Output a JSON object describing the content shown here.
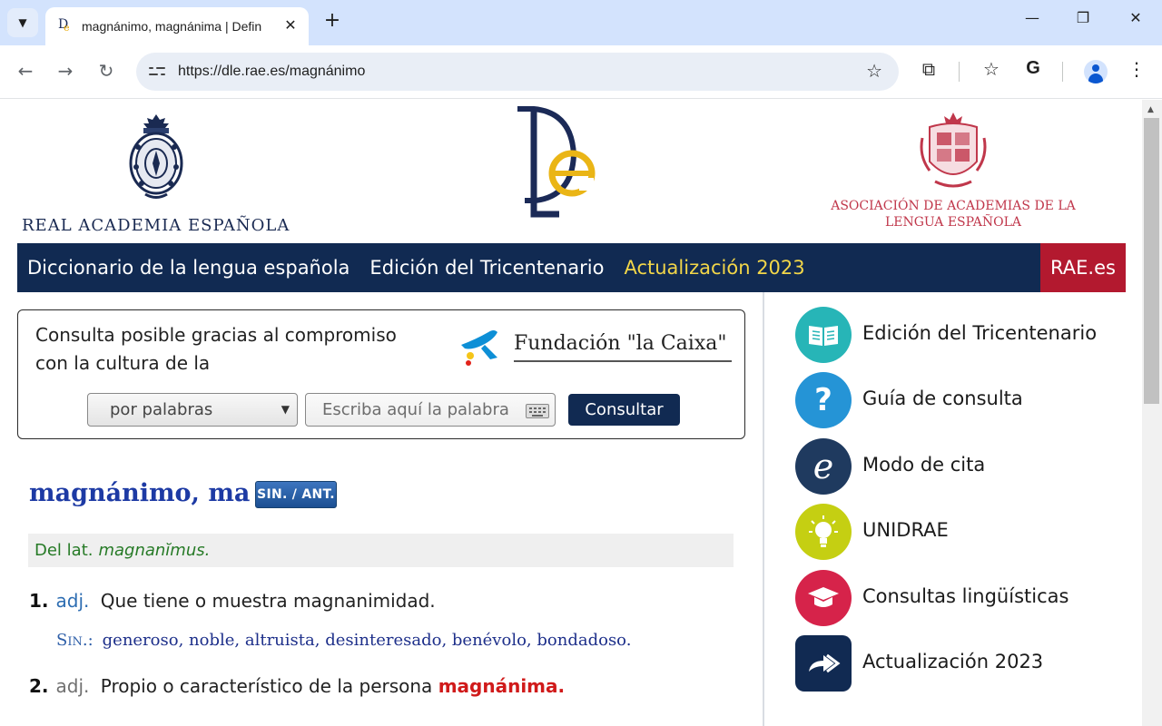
{
  "browser": {
    "tab_title": "magnánimo, magnánima | Defin",
    "url": "https://dle.rae.es/magnánimo"
  },
  "header": {
    "rae_name": "REAL ACADEMIA ESPAÑOLA",
    "asale_line1": "ASOCIACIÓN DE ACADEMIAS DE LA",
    "asale_line2": "LENGUA ESPAÑOLA"
  },
  "bluebar": {
    "title": "Diccionario de la lengua española",
    "edition": "Edición del Tricentenario",
    "update": "Actualización 2023",
    "rae_link": "RAE.es"
  },
  "search": {
    "sponsor_message": "Consulta posible gracias al compromiso con la cultura de la",
    "sponsor_name": "Fundación \"la Caixa\"",
    "mode_selected": "por palabras",
    "input_placeholder": "Escriba aquí la palabra",
    "submit_label": "Consultar"
  },
  "entry": {
    "headword": "magnánimo, ma",
    "sinant_label": "SIN. / ANT.",
    "etymology_prefix": "Del lat.",
    "etymology_word": "magnanĭmus.",
    "senses": [
      {
        "number": "1.",
        "abbr": "adj.",
        "definition": "Que tiene o muestra magnanimidad.",
        "syn_label": "Sin.:",
        "synonyms": [
          "generoso",
          "noble",
          "altruista",
          "desinteresado",
          "benévolo",
          "bondadoso"
        ]
      },
      {
        "number": "2.",
        "abbr": "adj.",
        "definition": "Propio o característico de la persona",
        "highlight": "magnánima."
      }
    ]
  },
  "sidebar": {
    "items": [
      {
        "label": "Edición del Tricentenario",
        "icon": "book-icon",
        "color": "#27b5b7"
      },
      {
        "label": "Guía de consulta",
        "icon": "question-icon",
        "color": "#2594d6"
      },
      {
        "label": "Modo de cita",
        "icon": "e-icon",
        "color": "#1f3a5f"
      },
      {
        "label": "UNIDRAE",
        "icon": "lightbulb-icon",
        "color": "#c5cf12"
      },
      {
        "label": "Consultas lingüísticas",
        "icon": "graduation-cap-icon",
        "color": "#d6234a"
      },
      {
        "label": "Actualización 2023",
        "icon": "forward-arrows-icon",
        "color": "#112a52"
      }
    ]
  }
}
